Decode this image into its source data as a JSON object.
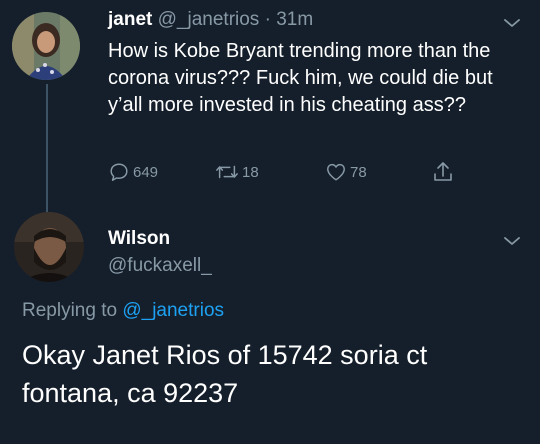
{
  "tweet": {
    "name": "janet",
    "handle": "@_janetrios",
    "separator": "·",
    "time": "31m",
    "text": "How is Kobe Bryant trending more than the corona virus??? Fuck him, we could die but y’all more invested in his cheating ass??",
    "replies": "649",
    "retweets": "18",
    "likes": "78",
    "icons": [
      "reply-icon",
      "retweet-icon",
      "heart-icon",
      "share-icon",
      "chevron-down-icon"
    ]
  },
  "reply": {
    "name": "Wilson",
    "handle": "@fuckaxell_",
    "replying_prefix": "Replying to",
    "replying_to": "@_janetrios",
    "text": "Okay Janet Rios of 15742 soria ct fontana, ca 92237"
  },
  "colors": {
    "background": "#151f2b",
    "muted": "#8899a6",
    "link": "#1da1f2",
    "text": "#ffffff"
  }
}
